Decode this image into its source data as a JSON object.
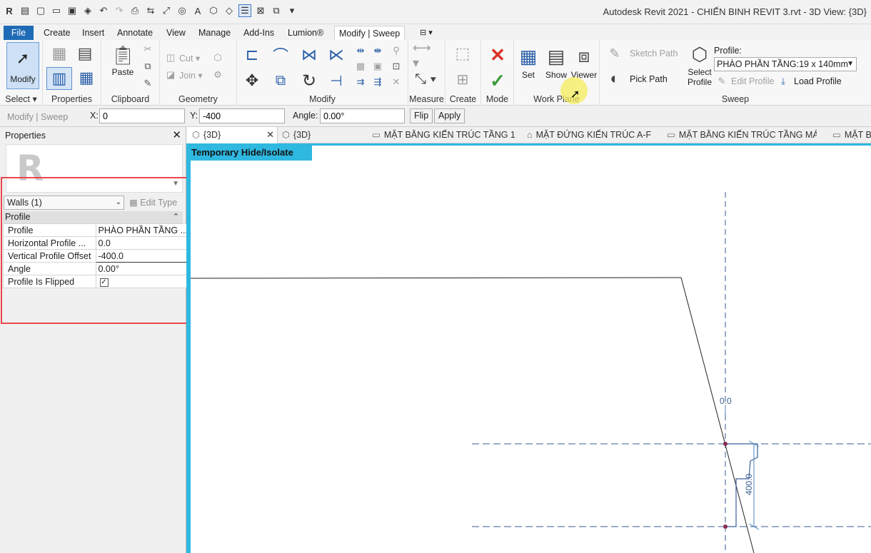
{
  "app": {
    "title": "Autodesk Revit 2021 - CHIẾN BINH REVIT 3.rvt - 3D View: {3D}",
    "logo": "R"
  },
  "ribbon_tabs": [
    "File",
    "Create",
    "Insert",
    "Annotate",
    "View",
    "Manage",
    "Add-Ins",
    "Lumion®",
    "Modify | Sweep"
  ],
  "panels": {
    "select": {
      "button": "Modify",
      "label": "Select"
    },
    "properties": {
      "label": "Properties"
    },
    "clipboard": {
      "paste": "Paste",
      "label": "Clipboard"
    },
    "geometry": {
      "cut": "Cut",
      "join": "Join",
      "label": "Geometry"
    },
    "modify": {
      "label": "Modify"
    },
    "measure": {
      "label": "Measure"
    },
    "create": {
      "label": "Create"
    },
    "mode": {
      "label": "Mode"
    },
    "workplane": {
      "set": "Set",
      "show": "Show",
      "viewer": "Viewer",
      "label": "Work Plane"
    },
    "sweep": {
      "sketch_path": "Sketch Path",
      "pick_path": "Pick Path",
      "select_profile": "Select Profile",
      "profile_label": "Profile:",
      "profile_value": "PHÀO PHẦN TẦNG:19 x 140mm",
      "edit_profile": "Edit Profile",
      "load_profile": "Load Profile",
      "label": "Sweep"
    }
  },
  "options_bar": {
    "context": "Modify | Sweep",
    "x_label": "X:",
    "x_value": "0",
    "y_label": "Y:",
    "y_value": "-400",
    "angle_label": "Angle:",
    "angle_value": "0.00°",
    "flip": "Flip",
    "apply": "Apply"
  },
  "properties_panel": {
    "header": "Properties",
    "type_selector": "Walls (1)",
    "edit_type": "Edit Type",
    "category": "Profile",
    "rows": [
      {
        "name": "Profile",
        "value": "PHÀO PHẦN TẦNG ..."
      },
      {
        "name": "Horizontal Profile ...",
        "value": "0.0"
      },
      {
        "name": "Vertical Profile Offset",
        "value": "-400.0"
      },
      {
        "name": "Angle",
        "value": "0.00°"
      },
      {
        "name": "Profile Is Flipped",
        "value": "✓"
      }
    ]
  },
  "view_tabs": [
    "{3D}",
    "{3D}",
    "MẶT BẰNG KIẾN TRÚC TẦNG 1",
    "MẶT ĐỨNG KIẾN TRÚC A-F",
    "MẶT BẰNG KIẾN TRÚC TẦNG MÁI",
    "MẶT B"
  ],
  "canvas": {
    "banner": "Temporary Hide/Isolate",
    "dim_top": "0.0",
    "dim_side": "400.0"
  },
  "colors": {
    "accent": "#1f6bb6",
    "isolate": "#2fb8e0",
    "highlight": "#e8474b"
  }
}
